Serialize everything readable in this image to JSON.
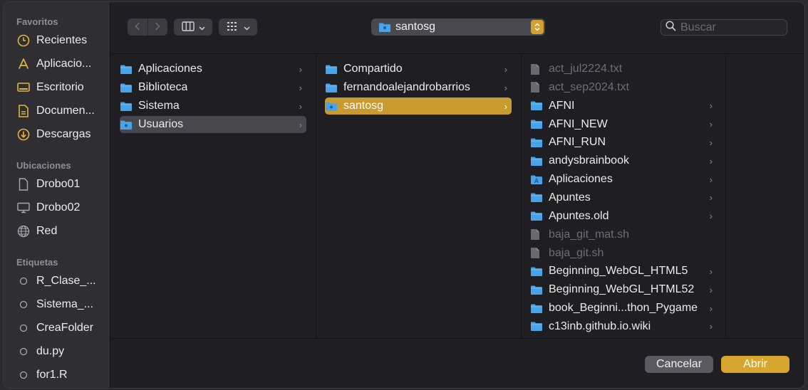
{
  "sidebar": {
    "favorites_title": "Favoritos",
    "favorites": [
      {
        "label": "Recientes",
        "icon": "clock-icon"
      },
      {
        "label": "Aplicacio...",
        "icon": "applications-icon"
      },
      {
        "label": "Escritorio",
        "icon": "desktop-icon"
      },
      {
        "label": "Documen...",
        "icon": "document-icon"
      },
      {
        "label": "Descargas",
        "icon": "download-icon"
      }
    ],
    "locations_title": "Ubicaciones",
    "locations": [
      {
        "label": "Drobo01",
        "icon": "file-icon"
      },
      {
        "label": "Drobo02",
        "icon": "monitor-icon"
      },
      {
        "label": "Red",
        "icon": "globe-icon"
      }
    ],
    "tags_title": "Etiquetas",
    "tags": [
      {
        "label": "R_Clase_..."
      },
      {
        "label": "Sistema_..."
      },
      {
        "label": "CreaFolder"
      },
      {
        "label": "du.py"
      },
      {
        "label": "for1.R"
      }
    ]
  },
  "toolbar": {
    "path_label": "santosg",
    "search_placeholder": "Buscar"
  },
  "columns": {
    "col1": [
      {
        "label": "Aplicaciones"
      },
      {
        "label": "Biblioteca"
      },
      {
        "label": "Sistema"
      },
      {
        "label": "Usuarios"
      }
    ],
    "col2": [
      {
        "label": "Compartido"
      },
      {
        "label": "fernandoalejandrobarrios"
      },
      {
        "label": "santosg"
      }
    ],
    "col3": [
      {
        "label": "act_jul2224.txt"
      },
      {
        "label": "act_sep2024.txt"
      },
      {
        "label": "AFNI"
      },
      {
        "label": "AFNI_NEW"
      },
      {
        "label": "AFNI_RUN"
      },
      {
        "label": "andysbrainbook"
      },
      {
        "label": "Aplicaciones"
      },
      {
        "label": "Apuntes"
      },
      {
        "label": "Apuntes.old"
      },
      {
        "label": "baja_git_mat.sh"
      },
      {
        "label": "baja_git.sh"
      },
      {
        "label": "Beginning_WebGL_HTML5"
      },
      {
        "label": "Beginning_WebGL_HTML52"
      },
      {
        "label": "book_Beginni...thon_Pygame"
      },
      {
        "label": "c13inb.github.io.wiki"
      }
    ]
  },
  "footer": {
    "cancel_label": "Cancelar",
    "open_label": "Abrir"
  },
  "colors": {
    "accent": "#d8a62f",
    "folder": "#4aa3e8"
  }
}
